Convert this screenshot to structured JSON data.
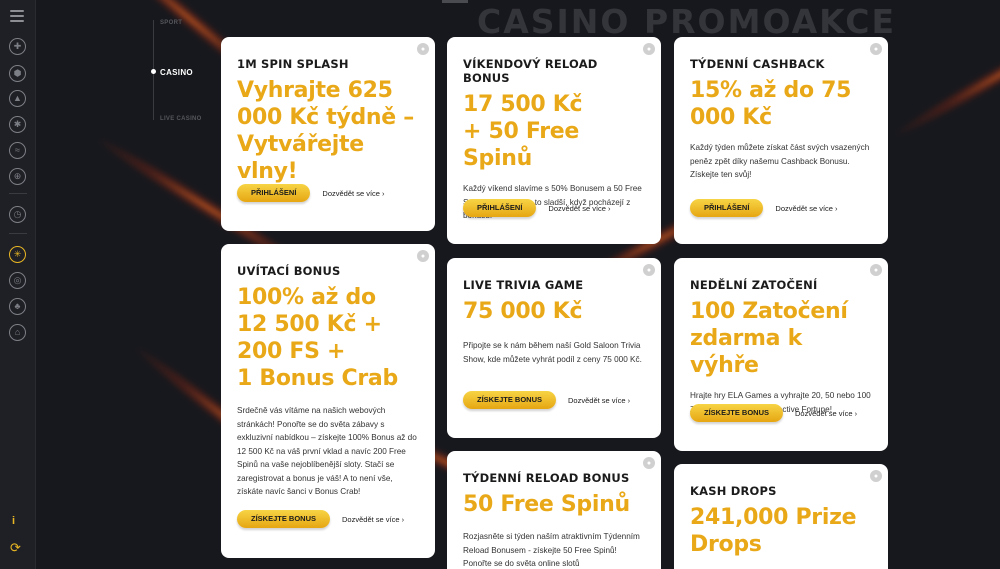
{
  "page": {
    "title": "CASINO PROMOAKCE",
    "accent_color": "#e9a817"
  },
  "subnav": {
    "items": [
      {
        "label": "SPORT",
        "active": false
      },
      {
        "label": "CASINO",
        "active": true
      },
      {
        "label": "LIVE CASINO",
        "active": false
      }
    ]
  },
  "sidebar": {
    "icons": [
      "menu-icon",
      "basketball-icon",
      "soccer-icon",
      "flame-icon",
      "volleyball-icon",
      "wifi-icon",
      "globe-icon",
      "clock-icon",
      "roulette-icon",
      "chip-icon",
      "poker-icon",
      "bank-icon"
    ],
    "info_glyph": "i",
    "sync_glyph": "⟳"
  },
  "cards": [
    {
      "title": "1M SPIN SPLASH",
      "headline": "Vyhrajte 625 000 Kč týdně – Vytvářejte vlny!",
      "description": "",
      "button": "PŘIHLÁŠENÍ",
      "more": "Dozvědět se více ›"
    },
    {
      "title": "VÍKENDOVÝ RELOAD BONUS",
      "headline": "17 500 Kč\n+ 50 Free Spinů",
      "description": "Každý víkend slavíme s 50% Bonusem a 50 Free Spiny. Výhry jsou o to sladší, když pocházejí z bonusu!",
      "button": "PŘIHLÁŠENÍ",
      "more": "Dozvědět se více ›"
    },
    {
      "title": "TÝDENNÍ CASHBACK",
      "headline": "15% až do 75 000 Kč",
      "description": "Každý týden můžete získat část svých vsazených peněz zpět díky našemu Cashback Bonusu. Získejte ten svůj!",
      "button": "PŘIHLÁŠENÍ",
      "more": "Dozvědět se více ›"
    },
    {
      "title": "UVÍTACÍ BONUS",
      "headline": "100% až do\n12 500 Kč +\n200 FS +\n1 Bonus Crab",
      "description": "Srdečně vás vítáme na našich webových stránkách! Ponořte se do světa zábavy s exkluzivní nabídkou – získejte 100% Bonus až do 12 500 Kč na váš první vklad a navíc 200 Free Spinů na vaše nejoblíbenější sloty. Stačí se zaregistrovat a bonus je váš! A to není vše, získáte navíc šanci v Bonus Crab!",
      "button": "ZÍSKEJTE BONUS",
      "more": "Dozvědět se více ›"
    },
    {
      "title": "LIVE TRIVIA GAME",
      "headline": "75 000 Kč",
      "description": "Připojte se k nám během naší Gold Saloon Trivia Show, kde můžete vyhrát podíl z ceny 75 000 Kč.",
      "button": "ZÍSKEJTE BONUS",
      "more": "Dozvědět se více ›"
    },
    {
      "title": "NEDĚLNÍ ZATOČENÍ",
      "headline": "100 Zatočení zdarma k výhře",
      "description": "Hrajte hry ELA Games a vyhrajte 20, 50 nebo 100 Zatočení zdarma na Detective Fortune!",
      "button": "ZÍSKEJTE BONUS",
      "more": "Dozvědět se více ›"
    },
    {
      "title": "TÝDENNÍ RELOAD BONUS",
      "headline": "50 Free Spinů",
      "description": "Rozjasněte si týden naším atraktivním Týdenním Reload Bonusem - získejte 50 Free Spinů! Ponořte se do světa online slotů",
      "button": "",
      "more": ""
    },
    {
      "title": "KASH DROPS",
      "headline": "241,000 Prize Drops",
      "description": "",
      "button": "",
      "more": ""
    }
  ]
}
